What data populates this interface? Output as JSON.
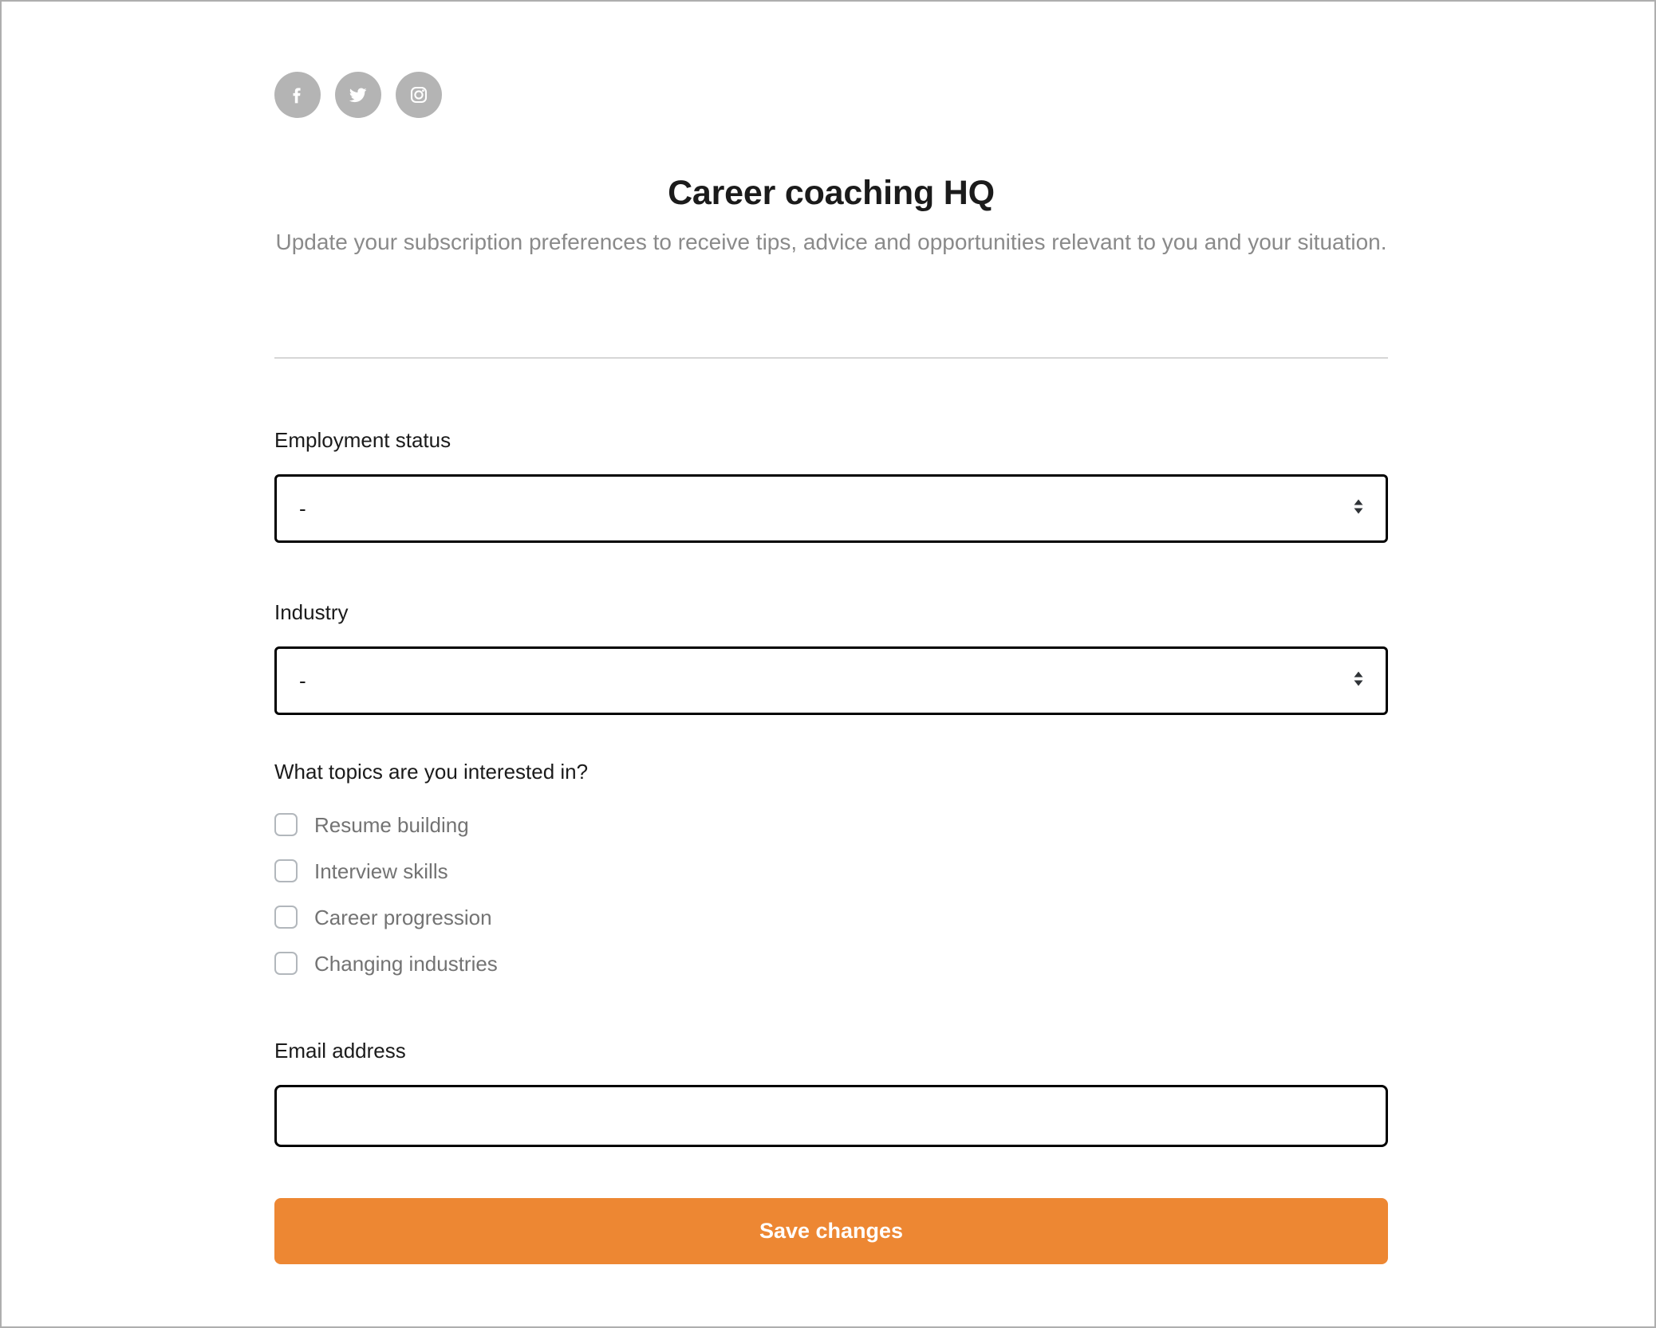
{
  "social": {
    "items": [
      {
        "name": "facebook",
        "icon": "facebook-icon",
        "color": "#b4b4b4"
      },
      {
        "name": "twitter",
        "icon": "twitter-icon",
        "color": "#b4b4b4"
      },
      {
        "name": "instagram",
        "icon": "instagram-icon",
        "color": "#b4b4b4"
      }
    ]
  },
  "header": {
    "title": "Career coaching HQ",
    "subtitle": "Update your subscription preferences to receive tips, advice and opportunities relevant to you and your situation."
  },
  "form": {
    "employment_status": {
      "label": "Employment status",
      "value": "-",
      "icon": "chevron-updown-icon"
    },
    "industry": {
      "label": "Industry",
      "value": "-",
      "icon": "chevron-updown-icon"
    },
    "topics": {
      "label": "What topics are you interested in?",
      "options": [
        {
          "label": "Resume building",
          "checked": false
        },
        {
          "label": "Interview skills",
          "checked": false
        },
        {
          "label": "Career progression",
          "checked": false
        },
        {
          "label": "Changing industries",
          "checked": false
        }
      ]
    },
    "email": {
      "label": "Email address",
      "value": "",
      "placeholder": ""
    },
    "submit": {
      "label": "Save changes",
      "color": "#ed8733",
      "text_color": "#ffffff"
    }
  },
  "theme": {
    "accent": "#ed8733",
    "text": "#1b1b1b",
    "muted_text": "#737373",
    "subtitle_text": "#8a8a8a",
    "divider": "#d6d6d6",
    "border": "#000000",
    "checkbox_border": "#b2b7bc",
    "page_border": "#aeaeae"
  }
}
